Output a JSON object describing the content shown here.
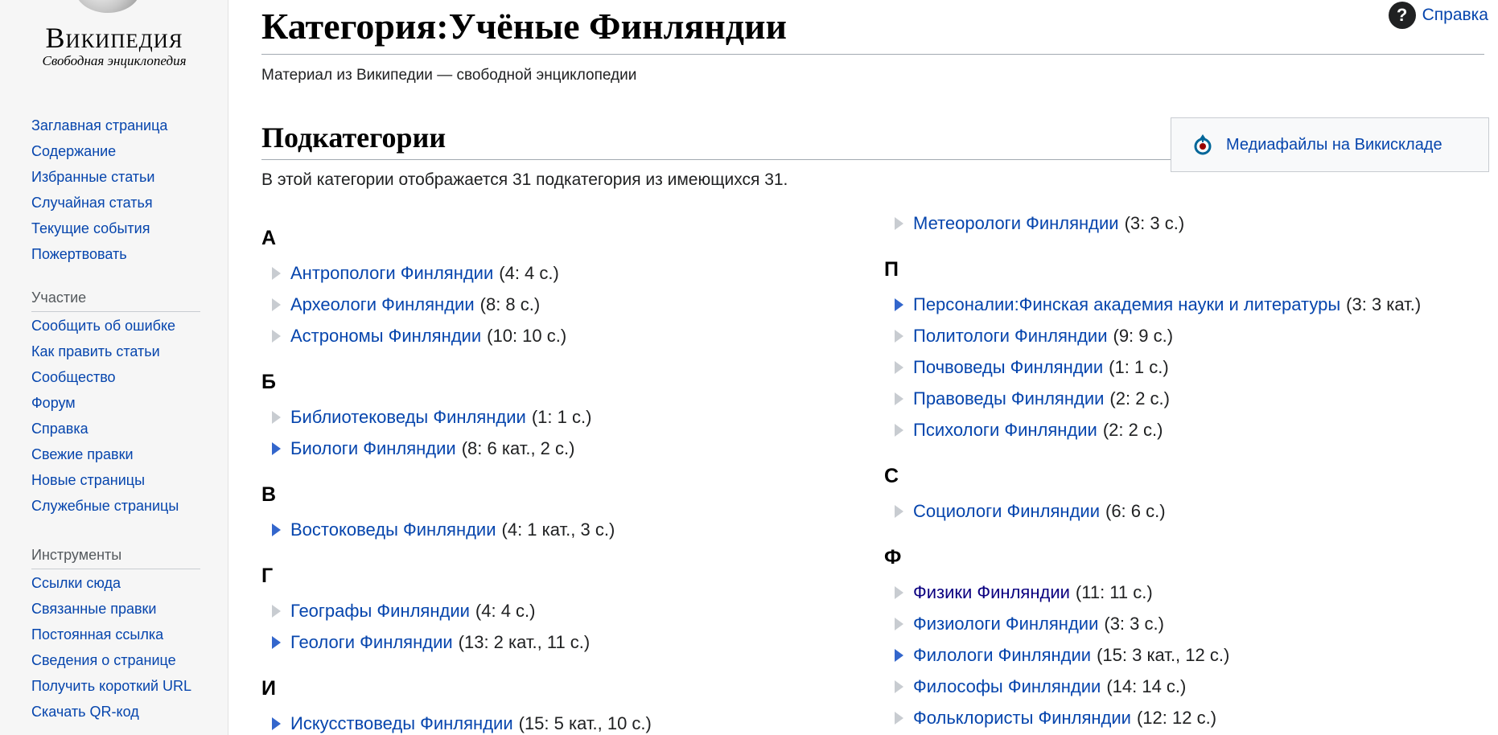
{
  "logo": {
    "wordmark": "Википедия",
    "tagline": "Свободная энциклопедия"
  },
  "sidebar": {
    "main": [
      "Заглавная страница",
      "Содержание",
      "Избранные статьи",
      "Случайная статья",
      "Текущие события",
      "Пожертвовать"
    ],
    "participation_heading": "Участие",
    "participation": [
      "Сообщить об ошибке",
      "Как править статьи",
      "Сообщество",
      "Форум",
      "Справка",
      "Свежие правки",
      "Новые страницы",
      "Служебные страницы"
    ],
    "tools_heading": "Инструменты",
    "tools": [
      "Ссылки сюда",
      "Связанные правки",
      "Постоянная ссылка",
      "Сведения о странице",
      "Получить короткий URL",
      "Скачать QR-код"
    ]
  },
  "header": {
    "help_label": "Справка",
    "help_icon": "question-circle-icon",
    "title": "Категория:Учёные Финляндии",
    "tagline": "Материал из Википедии — свободной энциклопедии"
  },
  "section": {
    "heading": "Подкатегории",
    "commons_label": "Медиафайлы на Викискладе",
    "count_text": "В этой категории отображается 31 подкатегория из имеющихся 31."
  },
  "colors": {
    "link": "#0645ad",
    "visited_link": "#0b0080",
    "expand_arrow": "#3366cc",
    "empty_arrow": "#c8ccd1",
    "sidebar_bg": "#f6f6f6"
  },
  "columns": [
    [
      {
        "letter": "А",
        "items": [
          {
            "name": "Антропологи Финляндии",
            "count": "(4: 4 с.)",
            "expandable": false
          },
          {
            "name": "Археологи Финляндии",
            "count": "(8: 8 с.)",
            "expandable": false
          },
          {
            "name": "Астрономы Финляндии",
            "count": "(10: 10 с.)",
            "expandable": false
          }
        ]
      },
      {
        "letter": "Б",
        "items": [
          {
            "name": "Библиотековеды Финляндии",
            "count": "(1: 1 с.)",
            "expandable": false
          },
          {
            "name": "Биологи Финляндии",
            "count": "(8: 6 кат., 2 с.)",
            "expandable": true
          }
        ]
      },
      {
        "letter": "В",
        "items": [
          {
            "name": "Востоковеды Финляндии",
            "count": "(4: 1 кат., 3 с.)",
            "expandable": true
          }
        ]
      },
      {
        "letter": "Г",
        "items": [
          {
            "name": "Географы Финляндии",
            "count": "(4: 4 с.)",
            "expandable": false
          },
          {
            "name": "Геологи Финляндии",
            "count": "(13: 2 кат., 11 с.)",
            "expandable": true
          }
        ]
      },
      {
        "letter": "И",
        "items": [
          {
            "name": "Искусствоведы Финляндии",
            "count": "(15: 5 кат., 10 с.)",
            "expandable": true
          }
        ]
      }
    ],
    [
      {
        "letter": "",
        "items": [
          {
            "name": "Метеорологи Финляндии",
            "count": "(3: 3 с.)",
            "expandable": false
          }
        ]
      },
      {
        "letter": "П",
        "items": [
          {
            "name": "Персоналии:Финская академия науки и литературы",
            "count": "(3: 3 кат.)",
            "expandable": true
          },
          {
            "name": "Политологи Финляндии",
            "count": "(9: 9 с.)",
            "expandable": false
          },
          {
            "name": "Почвоведы Финляндии",
            "count": "(1: 1 с.)",
            "expandable": false
          },
          {
            "name": "Правоведы Финляндии",
            "count": "(2: 2 с.)",
            "expandable": false
          },
          {
            "name": "Психологи Финляндии",
            "count": "(2: 2 с.)",
            "expandable": false
          }
        ]
      },
      {
        "letter": "С",
        "items": [
          {
            "name": "Социологи Финляндии",
            "count": "(6: 6 с.)",
            "expandable": false
          }
        ]
      },
      {
        "letter": "Ф",
        "items": [
          {
            "name": "Физики Финляндии",
            "count": "(11: 11 с.)",
            "expandable": false,
            "visited": true
          },
          {
            "name": "Физиологи Финляндии",
            "count": "(3: 3 с.)",
            "expandable": false
          },
          {
            "name": "Филологи Финляндии",
            "count": "(15: 3 кат., 12 с.)",
            "expandable": true
          },
          {
            "name": "Философы Финляндии",
            "count": "(14: 14 с.)",
            "expandable": false
          },
          {
            "name": "Фольклористы Финляндии",
            "count": "(12: 12 с.)",
            "expandable": false
          }
        ]
      }
    ]
  ]
}
